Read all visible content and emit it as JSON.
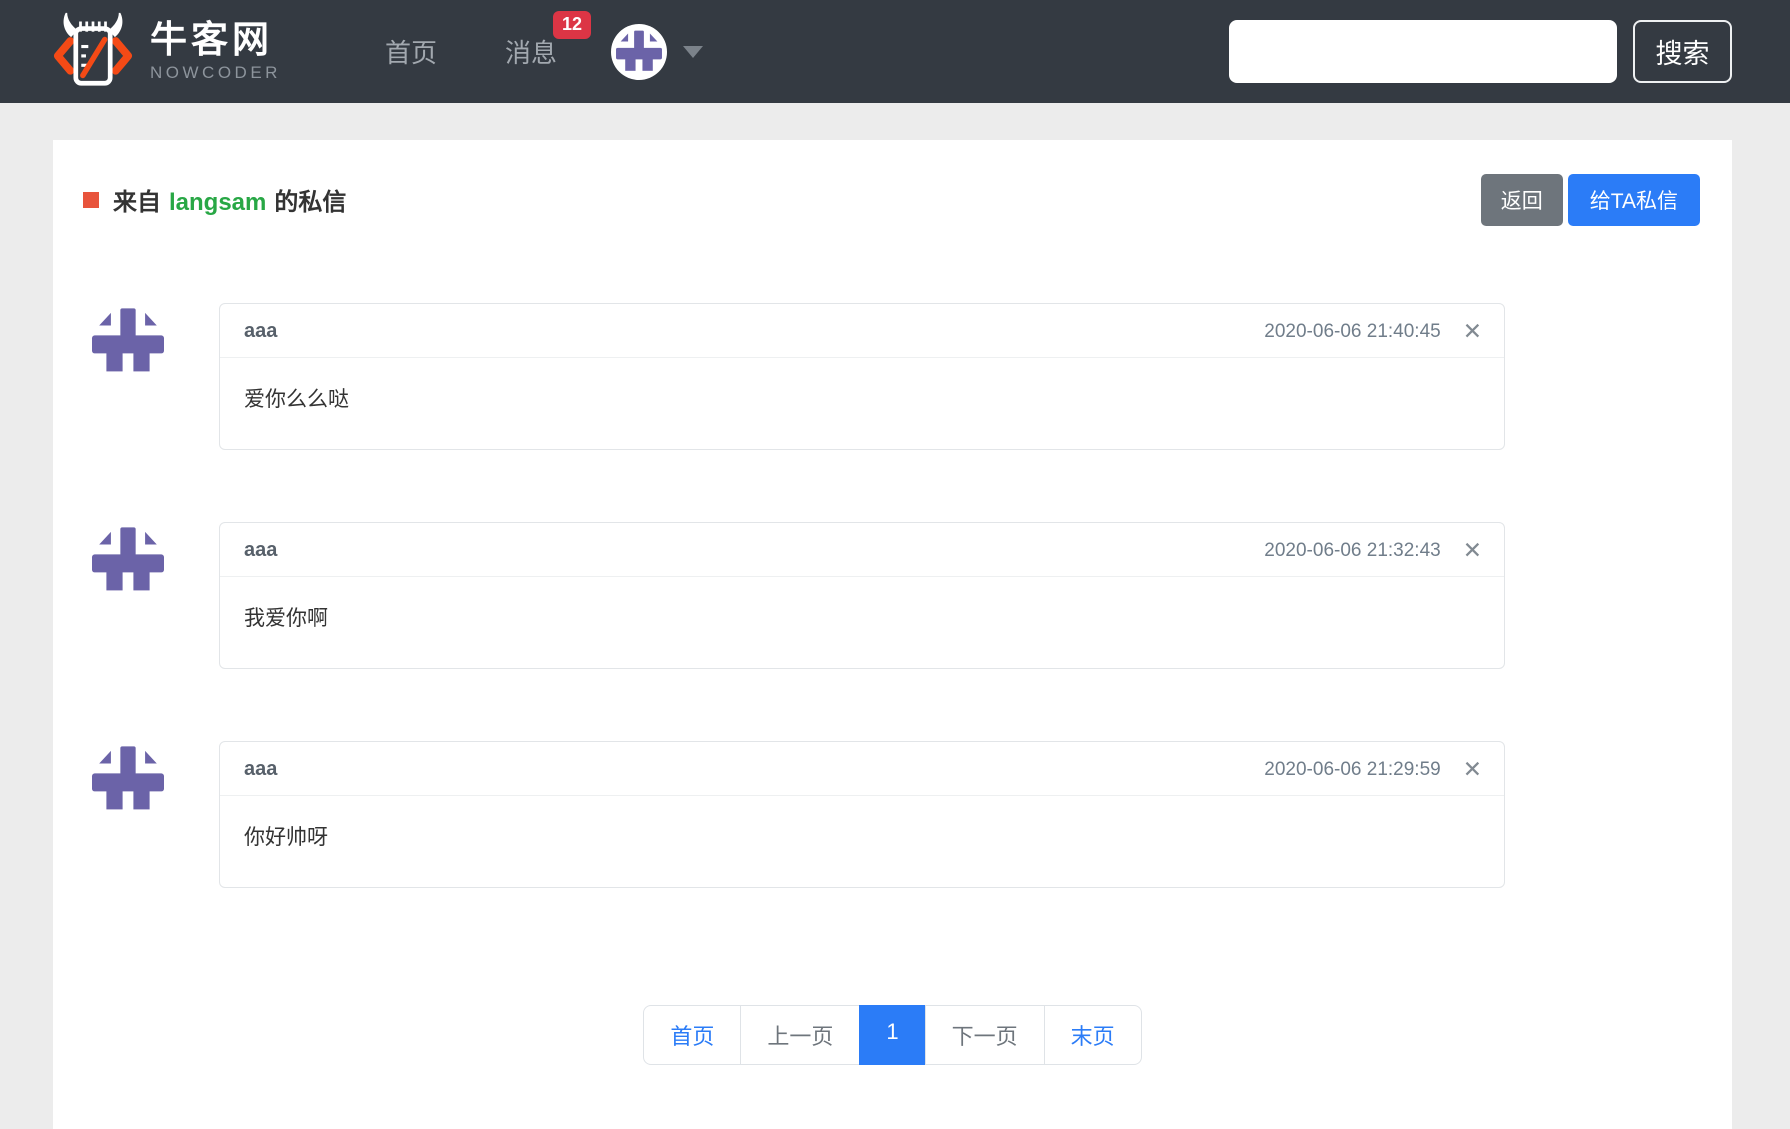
{
  "navbar": {
    "brand": {
      "name": "牛客网",
      "subtitle": "NOWCODER"
    },
    "links": {
      "home": "首页",
      "messages": "消息"
    },
    "messages_badge": "12",
    "search": {
      "value": "",
      "button_label": "搜索"
    }
  },
  "page": {
    "title": {
      "prefix": "来自",
      "username": "langsam",
      "suffix": "的私信"
    },
    "back_button": "返回",
    "pm_button": "给TA私信"
  },
  "messages": [
    {
      "sender": "aaa",
      "time": "2020-06-06 21:40:45",
      "content": "爱你么么哒"
    },
    {
      "sender": "aaa",
      "time": "2020-06-06 21:32:43",
      "content": "我爱你啊"
    },
    {
      "sender": "aaa",
      "time": "2020-06-06 21:29:59",
      "content": "你好帅呀"
    }
  ],
  "icons": {
    "close": "✕"
  },
  "pagination": {
    "first": "首页",
    "prev": "上一页",
    "current": "1",
    "next": "下一页",
    "last": "末页"
  },
  "colors": {
    "navbar_dark": "#343a42",
    "logo_orange": "#f44a16",
    "badge_red": "#dc3545",
    "marker_red": "#e8543c",
    "username_green": "#28a745",
    "primary_blue": "#2b7cf7",
    "button_gray": "#6e757c",
    "identicon_purple": "#6b63a8"
  }
}
